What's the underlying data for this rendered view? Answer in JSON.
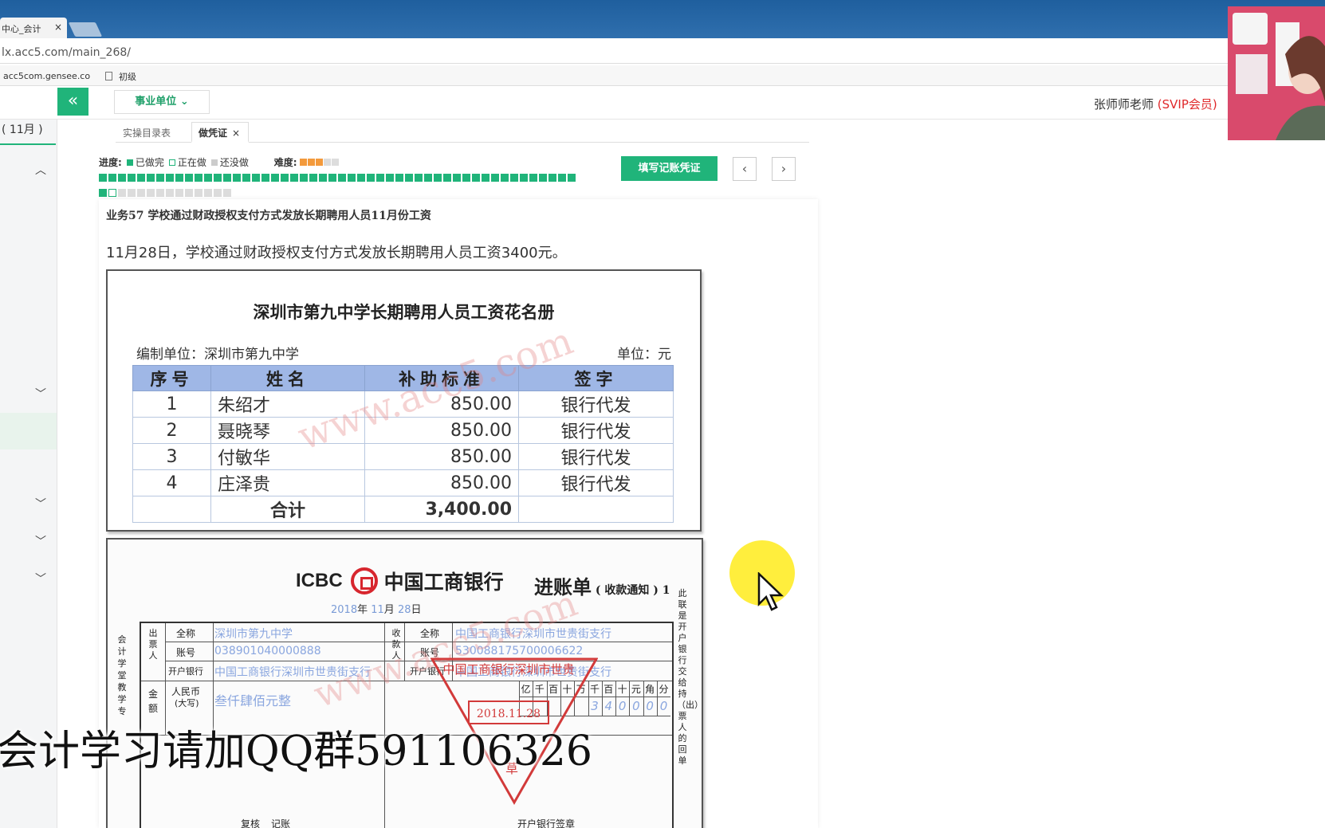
{
  "browser": {
    "tab_title": "中心_会计",
    "tab_close": "×",
    "url": "lx.acc5.com/main_268/",
    "bookmarks": [
      "acc5com.gensee.co",
      "初级"
    ]
  },
  "app": {
    "collapse_icon": "«",
    "unit_dropdown": "事业单位",
    "user_name": "张师师老师",
    "user_level": "(SVIP会员)",
    "month_tab": "( 11月 )"
  },
  "subtabs": {
    "tab1": "实操目录表",
    "tab2": "做凭证",
    "close": "×"
  },
  "progress": {
    "label": "进度:",
    "done": "已做完",
    "doing": "正在做",
    "todo": "还没做",
    "difficulty_label": "难度:",
    "difficulty_rating": 3,
    "difficulty_max": 5,
    "completed_count": 51,
    "current_index": 52,
    "total_count": 64
  },
  "buttons": {
    "fill_voucher": "填写记账凭证",
    "prev": "‹",
    "next": "›"
  },
  "task": {
    "title": "业务57 学校通过财政授权支付方式发放长期聘用人员11月份工资",
    "description": "11月28日，学校通过财政授权支付方式发放长期聘用人员工资3400元。"
  },
  "payroll": {
    "title": "深圳市第九中学长期聘用人员工资花名册",
    "org": "编制单位：深圳市第九中学",
    "unit": "单位：元",
    "headers": [
      "序号",
      "姓名",
      "补助标准",
      "签字"
    ],
    "rows": [
      [
        "1",
        "朱绍才",
        "850.00",
        "银行代发"
      ],
      [
        "2",
        "聂晓琴",
        "850.00",
        "银行代发"
      ],
      [
        "3",
        "付敏华",
        "850.00",
        "银行代发"
      ],
      [
        "4",
        "庄泽贵",
        "850.00",
        "银行代发"
      ]
    ],
    "total_label": "合计",
    "total_value": "3,400.00",
    "watermark": "www.acc5.com"
  },
  "bank_slip": {
    "brand_en": "ICBC",
    "brand_cn": "中国工商银行",
    "title": "进账单",
    "subtitle": "( 收款通知 )",
    "copy_no": "1",
    "date_year": "2018",
    "date_month": "11",
    "date_day": "28",
    "date_units": [
      "年",
      "月",
      "日"
    ],
    "payer_label": "出票人",
    "payee_label": "收款人",
    "field_fullname": "全称",
    "field_account": "账号",
    "field_bank": "开户银行",
    "payer_name": "深圳市第九中学",
    "payer_account": "038901040000888",
    "payer_bank": "中国工商银行深圳市世贵街支行",
    "payee_name": "中国工商银行深圳市世贵街支行",
    "payee_account": "530088175700006622",
    "payee_bank": "中国工商银行深圳市世贵街支行",
    "amount_label": "金额",
    "rmb_label": "人民币",
    "rmb_sub": "(大写)",
    "amount_words": "叁仟肆佰元整",
    "digit_headers": [
      "亿",
      "千",
      "百",
      "十",
      "万",
      "千",
      "百",
      "十",
      "元",
      "角",
      "分"
    ],
    "amount_digits": [
      "",
      "",
      "",
      "",
      "",
      "3",
      "4",
      "0",
      "0",
      "0",
      "0"
    ],
    "reviewer": "复核",
    "bookkeeper": "记账",
    "bank_sign": "开户银行签章",
    "side_note": "此联是开户银行交给持（出）票人的回单",
    "left_note": "会计学堂教学专",
    "stamp_bank": "中国工商银行深圳市世贵",
    "stamp_date": "2018.11.28",
    "stamp_char": "草"
  },
  "overlay": {
    "qq_text": "会计学习请加QQ群591106326"
  },
  "colors": {
    "accent_green": "#20b47a",
    "vip_red": "#e0292b",
    "table_header": "#9fb7e6",
    "icbc_red": "#d7262e",
    "stamp_red": "#d23a3a"
  }
}
